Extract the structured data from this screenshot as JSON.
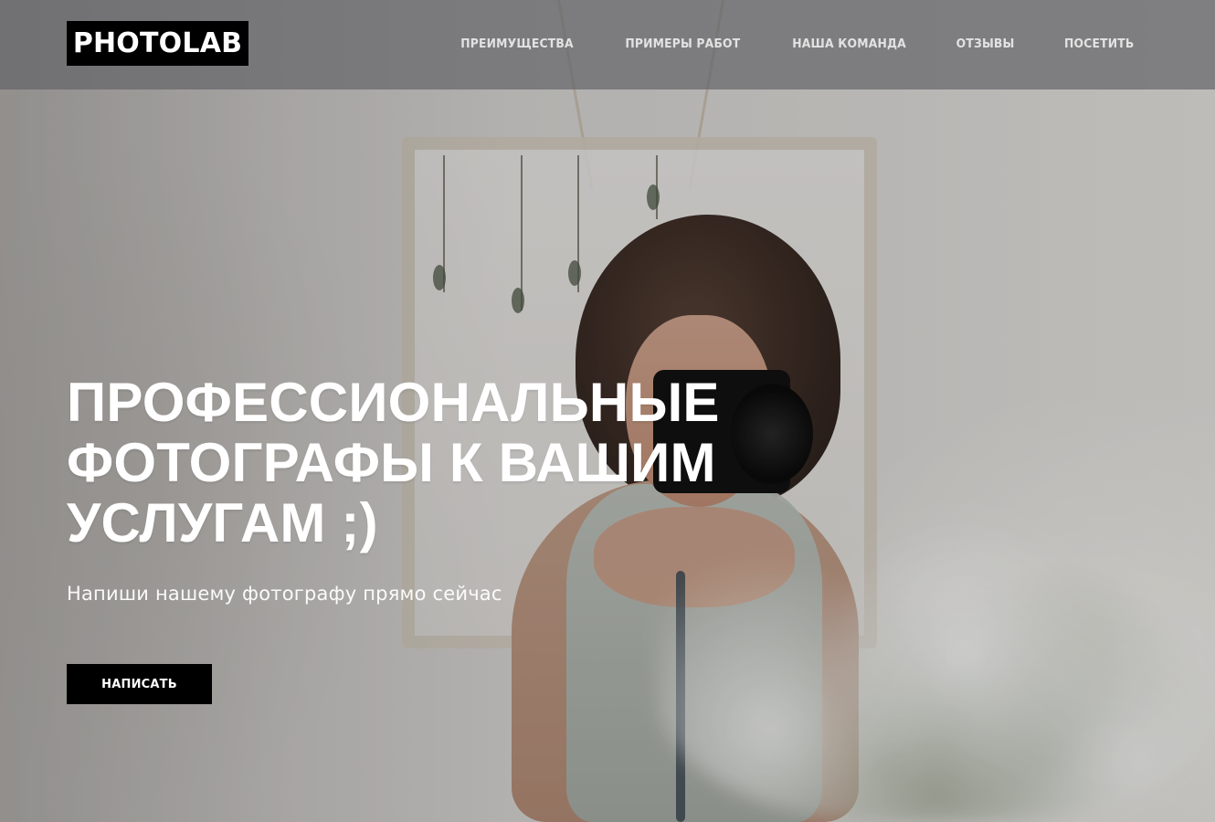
{
  "brand": {
    "logo_text": "PHOTOLAB"
  },
  "nav": {
    "items": [
      {
        "label": "ПРЕИМУЩЕСТВА"
      },
      {
        "label": "ПРИМЕРЫ РАБОТ"
      },
      {
        "label": "НАША КОМАНДА"
      },
      {
        "label": "ОТЗЫВЫ"
      },
      {
        "label": "ПОСЕТИТЬ"
      }
    ]
  },
  "hero": {
    "title_lines": [
      "ПРОФЕССИОНАЛЬНЫЕ",
      "ФОТОГРАФЫ К ВАШИМ",
      "УСЛУГАМ ;)"
    ],
    "subtitle": "Напиши нашему фотографу прямо сейчас",
    "button_label": "НАПИСАТЬ"
  },
  "colors": {
    "header_overlay": "#626266",
    "logo_bg": "#000000",
    "button_bg": "#000000",
    "text_light": "#ffffff"
  }
}
